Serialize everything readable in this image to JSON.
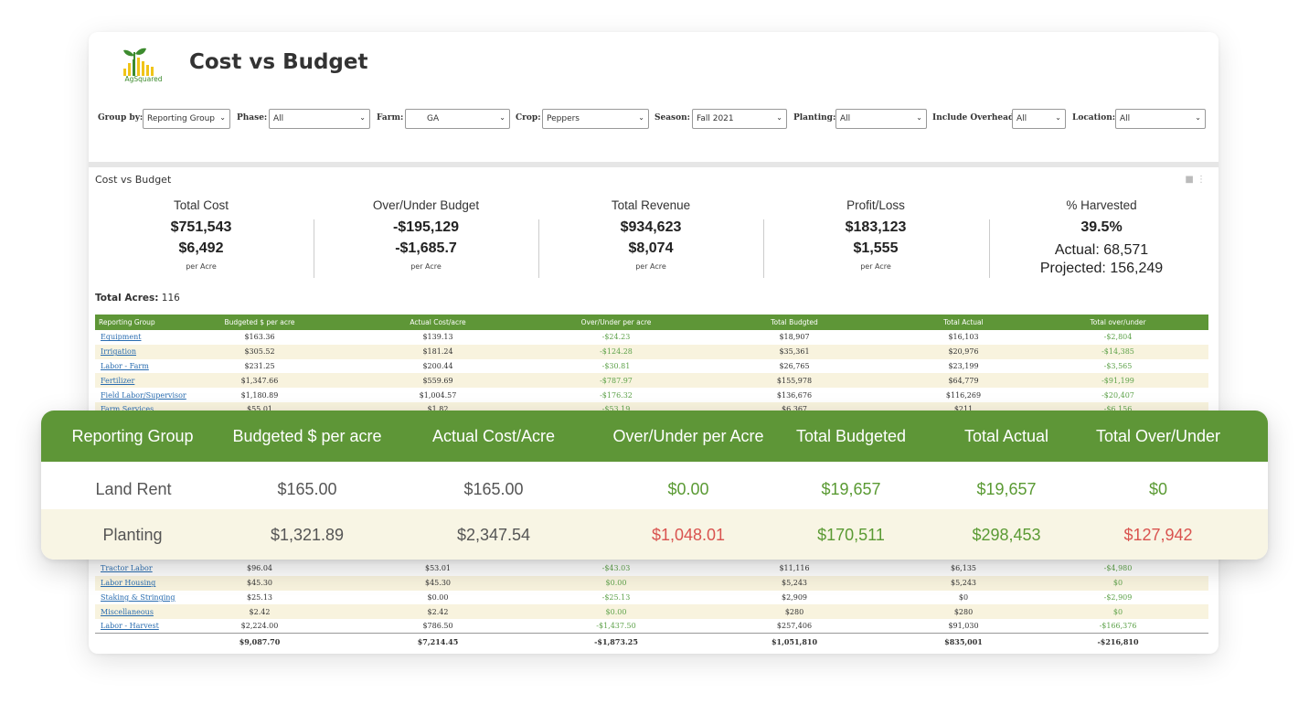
{
  "app": {
    "logo_text": "AgSquared",
    "title": "Cost vs Budget"
  },
  "filters": [
    {
      "label": "Group by:",
      "value": "Reporting Group"
    },
    {
      "label": "Phase:",
      "value": "All"
    },
    {
      "label": "Farm:",
      "value": "GA"
    },
    {
      "label": "Crop:",
      "value": "Peppers"
    },
    {
      "label": "Season:",
      "value": "Fall 2021"
    },
    {
      "label": "Planting:",
      "value": "All"
    },
    {
      "label": "Include Overhead:",
      "value": "All"
    },
    {
      "label": "Location:",
      "value": "All"
    }
  ],
  "panel": {
    "title": "Cost vs Budget"
  },
  "kpis": [
    {
      "label": "Total Cost",
      "value": "$751,543",
      "per_acre": "$6,492",
      "unit": "per Acre"
    },
    {
      "label": "Over/Under Budget",
      "value": "-$195,129",
      "per_acre": "-$1,685.7",
      "unit": "per Acre"
    },
    {
      "label": "Total Revenue",
      "value": "$934,623",
      "per_acre": "$8,074",
      "unit": "per Acre"
    },
    {
      "label": "Profit/Loss",
      "value": "$183,123",
      "per_acre": "$1,555",
      "unit": "per Acre"
    },
    {
      "label": "% Harvested",
      "value": "39.5%",
      "actual": "Actual: 68,571",
      "projected": "Projected: 156,249"
    }
  ],
  "acres": {
    "label": "Total Acres:",
    "value": "116"
  },
  "table": {
    "headers": [
      "Reporting Group",
      "Budgeted $ per acre",
      "Actual Cost/acre",
      "Over/Under per acre",
      "Total Budgted",
      "Total Actual",
      "Total over/under"
    ],
    "rows": [
      [
        "Equipment",
        "$163.36",
        "$139.13",
        "-$24.23",
        "$18,907",
        "$16,103",
        "-$2,804"
      ],
      [
        "Irrigation",
        "$305.52",
        "$181.24",
        "-$124.28",
        "$35,361",
        "$20,976",
        "-$14,385"
      ],
      [
        "Labor - Farm",
        "$231.25",
        "$200.44",
        "-$30.81",
        "$26,765",
        "$23,199",
        "-$3,565"
      ],
      [
        "Fertilizer",
        "$1,347.66",
        "$559.69",
        "-$787.97",
        "$155,978",
        "$64,779",
        "-$91,199"
      ],
      [
        "Field Labor/Supervisor",
        "$1,180.89",
        "$1,004.57",
        "-$176.32",
        "$136,676",
        "$116,269",
        "-$20,407"
      ],
      [
        "Farm Services",
        "$55.01",
        "$1.82",
        "-$53.19",
        "$6,367",
        "$211",
        "-$6,156"
      ]
    ],
    "lower_rows": [
      [
        "Tractor Labor",
        "$96.04",
        "$53.01",
        "-$43.03",
        "$11,116",
        "$6,135",
        "-$4,980"
      ],
      [
        "Labor Housing",
        "$45.30",
        "$45.30",
        "$0.00",
        "$5,243",
        "$5,243",
        "$0"
      ],
      [
        "Staking & Stringing",
        "$25.13",
        "$0.00",
        "-$25.13",
        "$2,909",
        "$0",
        "-$2,909"
      ],
      [
        "Miscellaneous",
        "$2.42",
        "$2.42",
        "$0.00",
        "$280",
        "$280",
        "$0"
      ],
      [
        "Labor - Harvest",
        "$2,224.00",
        "$786.50",
        "-$1,437.50",
        "$257,406",
        "$91,030",
        "-$166,376"
      ]
    ],
    "totals": [
      "",
      "$9,087.70",
      "$7,214.45",
      "-$1,873.25",
      "$1,051,810",
      "$835,001",
      "-$216,810"
    ]
  },
  "highlight": {
    "headers": [
      "Reporting Group",
      "Budgeted $ per acre",
      "Actual Cost/Acre",
      "Over/Under per Acre",
      "Total Budgeted",
      "Total Actual",
      "Total Over/Under"
    ],
    "rows": [
      [
        "Land Rent",
        "$165.00",
        "$165.00",
        "$0.00",
        "$19,657",
        "$19,657",
        "$0"
      ],
      [
        "Planting",
        "$1,321.89",
        "$2,347.54",
        "$1,048.01",
        "$170,511",
        "$298,453",
        "$127,942"
      ]
    ]
  },
  "colors": {
    "header_green": "#5e9637",
    "positive_green": "#5a9a33",
    "negative_red": "#d9534f",
    "alt_row": "#f8f3de"
  }
}
